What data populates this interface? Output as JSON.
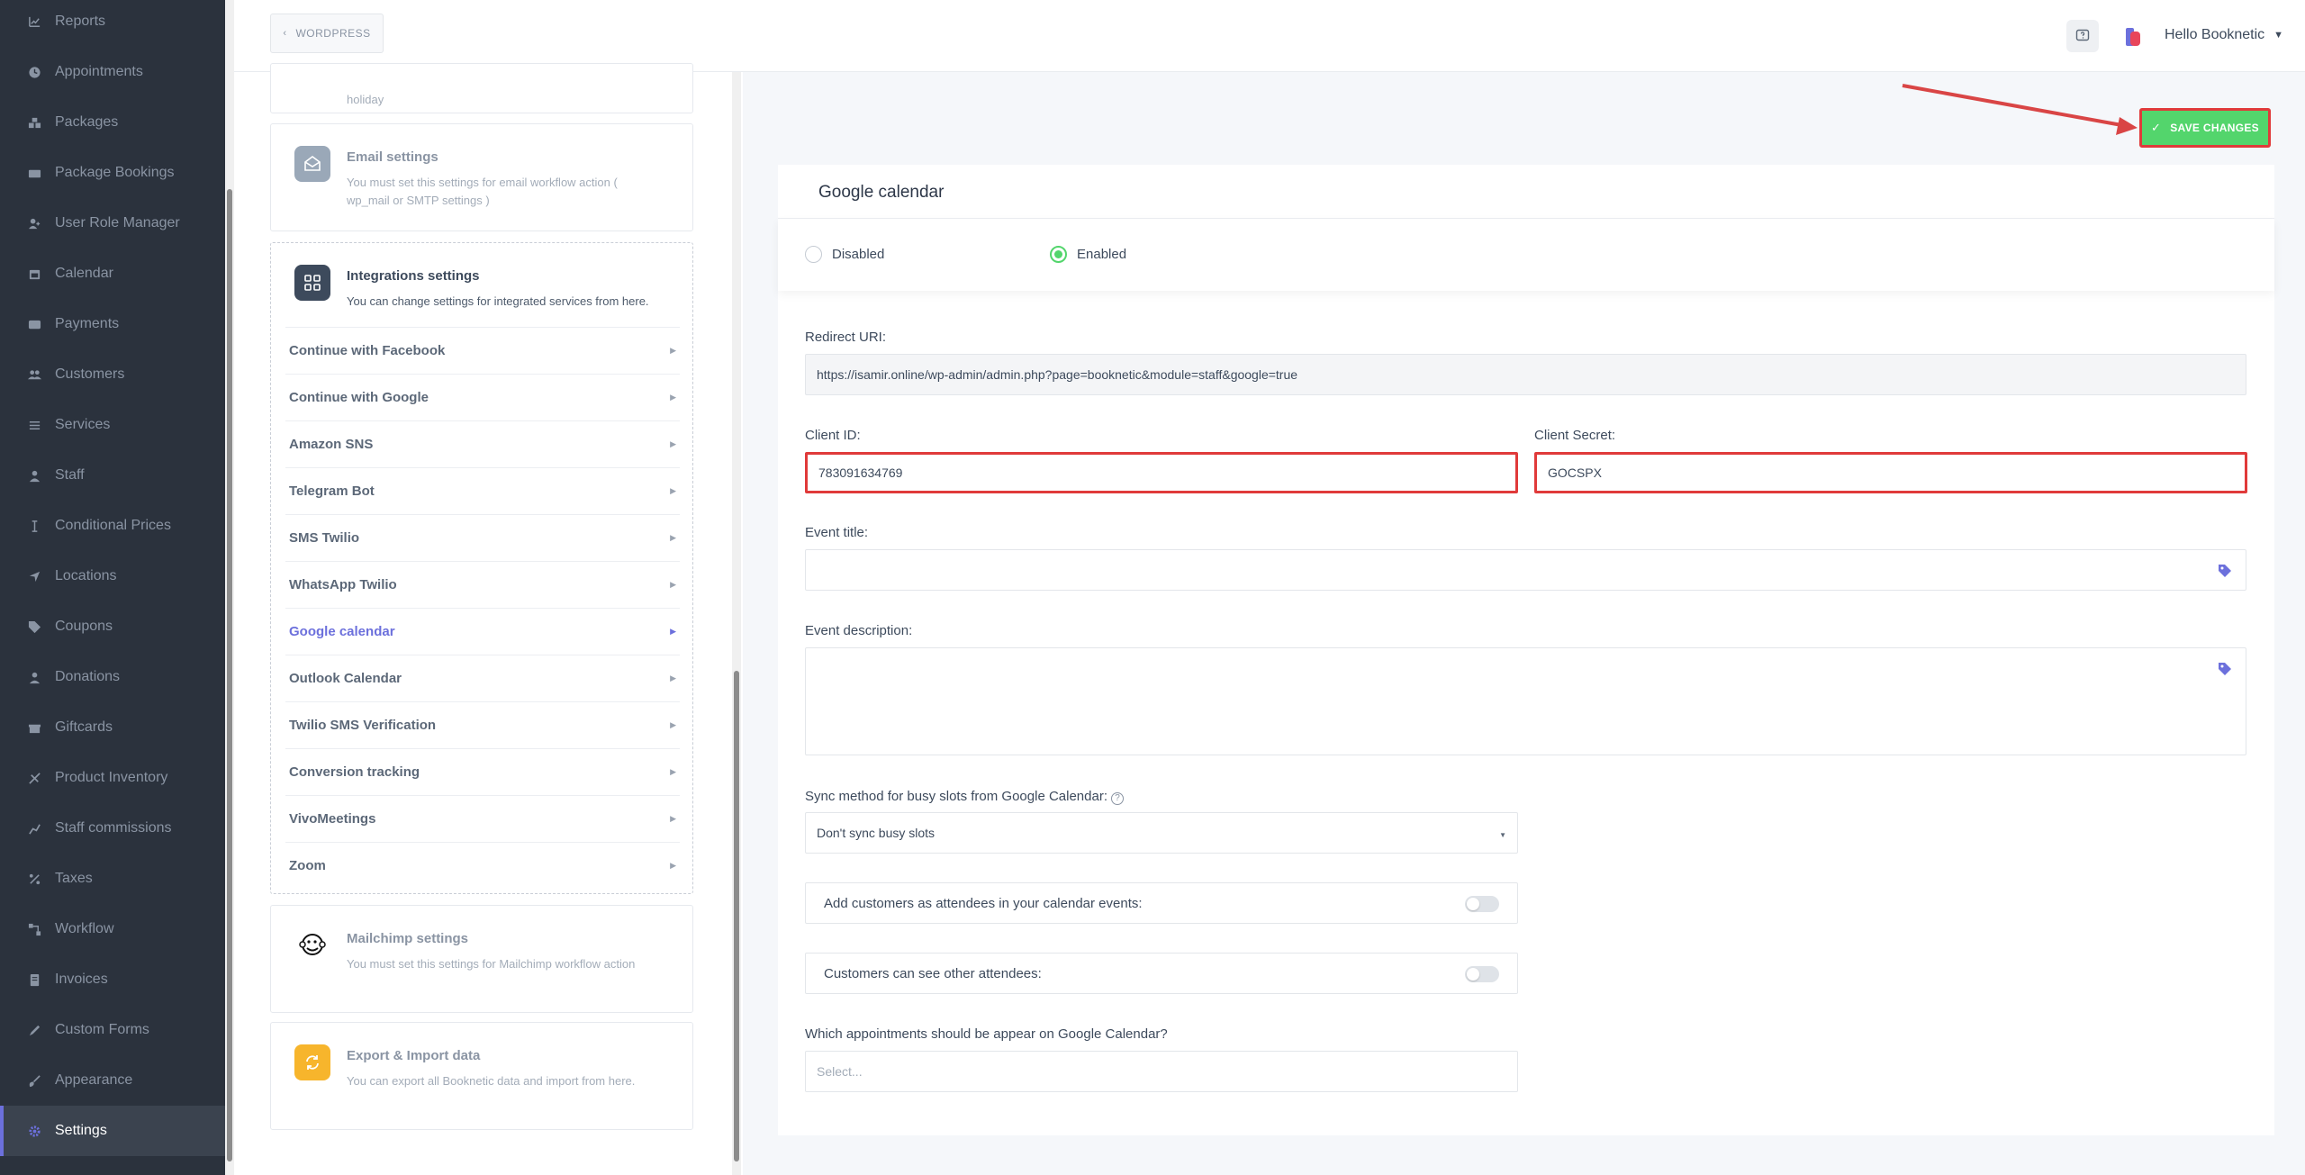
{
  "sidebar": {
    "items": [
      {
        "label": "Reports",
        "icon": "chart-icon"
      },
      {
        "label": "Appointments",
        "icon": "clock-icon"
      },
      {
        "label": "Packages",
        "icon": "boxes-icon"
      },
      {
        "label": "Package Bookings",
        "icon": "package-booking-icon"
      },
      {
        "label": "User Role Manager",
        "icon": "user-role-icon"
      },
      {
        "label": "Calendar",
        "icon": "calendar-icon"
      },
      {
        "label": "Payments",
        "icon": "wallet-icon"
      },
      {
        "label": "Customers",
        "icon": "users-icon"
      },
      {
        "label": "Services",
        "icon": "list-icon"
      },
      {
        "label": "Staff",
        "icon": "user-icon"
      },
      {
        "label": "Conditional Prices",
        "icon": "price-icon"
      },
      {
        "label": "Locations",
        "icon": "location-arrow-icon"
      },
      {
        "label": "Coupons",
        "icon": "tag-icon"
      },
      {
        "label": "Donations",
        "icon": "donation-icon"
      },
      {
        "label": "Giftcards",
        "icon": "gift-icon"
      },
      {
        "label": "Product Inventory",
        "icon": "inventory-icon"
      },
      {
        "label": "Staff commissions",
        "icon": "commission-icon"
      },
      {
        "label": "Taxes",
        "icon": "percent-icon"
      },
      {
        "label": "Workflow",
        "icon": "workflow-icon"
      },
      {
        "label": "Invoices",
        "icon": "invoice-icon"
      },
      {
        "label": "Custom Forms",
        "icon": "pen-icon"
      },
      {
        "label": "Appearance",
        "icon": "brush-icon"
      },
      {
        "label": "Settings",
        "icon": "gear-icon",
        "active": true
      }
    ]
  },
  "topbar": {
    "back_label": "WORDPRESS",
    "user_greeting": "Hello Booknetic"
  },
  "settings_list": {
    "holiday_desc_tail": "holiday",
    "email": {
      "title": "Email settings",
      "desc": "You must set this settings for email workflow action ( wp_mail or SMTP settings )"
    },
    "integrations": {
      "title": "Integrations settings",
      "desc": "You can change settings for integrated services from here.",
      "items": [
        "Continue with Facebook",
        "Continue with Google",
        "Amazon SNS",
        "Telegram Bot",
        "SMS Twilio",
        "WhatsApp Twilio",
        "Google calendar",
        "Outlook Calendar",
        "Twilio SMS Verification",
        "Conversion tracking",
        "VivoMeetings",
        "Zoom"
      ],
      "active_item": "Google calendar"
    },
    "mailchimp": {
      "title": "Mailchimp settings",
      "desc": "You must set this settings for Mailchimp workflow action"
    },
    "export": {
      "title": "Export & Import data",
      "desc": "You can export all Booknetic data and import from here."
    }
  },
  "main": {
    "save_label": "SAVE CHANGES",
    "title": "Google calendar",
    "status_disabled": "Disabled",
    "status_enabled": "Enabled",
    "redirect_uri_label": "Redirect URI:",
    "redirect_uri_value": "https://isamir.online/wp-admin/admin.php?page=booknetic&module=staff&google=true",
    "client_id_label": "Client ID:",
    "client_id_value": "783091634769",
    "client_secret_label": "Client Secret:",
    "client_secret_value": "GOCSPX",
    "event_title_label": "Event title:",
    "event_desc_label": "Event description:",
    "sync_label": "Sync method for busy slots from Google Calendar:",
    "sync_value": "Don't sync busy slots",
    "attendees_label": "Add customers as attendees in your calendar events:",
    "see_attendees_label": "Customers can see other attendees:",
    "appointments_label": "Which appointments should be appear on Google Calendar?",
    "appointments_placeholder": "Select..."
  },
  "colors": {
    "sidebar_bg": "#2b323d",
    "accent": "#6c70dc",
    "success": "#53d56c",
    "highlight": "#e03a3a"
  }
}
